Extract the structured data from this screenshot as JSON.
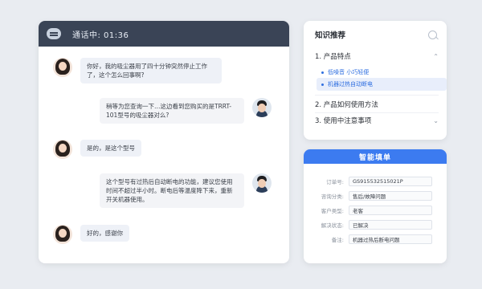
{
  "chat": {
    "status_text": "通话中: 01:36",
    "messages": [
      {
        "from": "customer",
        "text": "你好，我的吸尘器用了四十分钟突然停止工作了，这个怎么回事啊?"
      },
      {
        "from": "agent",
        "text": "稍等为您查询一下…这边看到您购买的是TRRT-101型号的吸尘器对么?"
      },
      {
        "from": "customer",
        "text": "是的，是这个型号"
      },
      {
        "from": "agent",
        "text": "这个型号有过热后自动断电的功能，建议您使用时间不超过半小时。断电后等温度降下来，重新开关机器使用。"
      },
      {
        "from": "customer",
        "text": "好的，感谢你"
      }
    ]
  },
  "knowledge": {
    "title": "知识推荐",
    "items": [
      {
        "label": "1. 产品特点",
        "expanded": true,
        "subitems": [
          {
            "label": "低噪音 小巧轻便",
            "active": false
          },
          {
            "label": "机器过热自动断电",
            "active": true
          }
        ]
      },
      {
        "label": "2. 产品如何使用方法",
        "expanded": false
      },
      {
        "label": "3. 使用中注意事项",
        "expanded": false
      }
    ]
  },
  "form": {
    "title": "智能填单",
    "fields": [
      {
        "label": "订单号:",
        "value": "GS915532515021P"
      },
      {
        "label": "咨询分类:",
        "value": "售后/故障问题"
      },
      {
        "label": "客户类型:",
        "value": "老客"
      },
      {
        "label": "解决状态:",
        "value": "已解决"
      },
      {
        "label": "备注:",
        "value": "机器过热后断电问题"
      }
    ]
  },
  "colors": {
    "accent": "#3c7bf0",
    "header": "#3a4456",
    "link": "#2f6fe0"
  }
}
